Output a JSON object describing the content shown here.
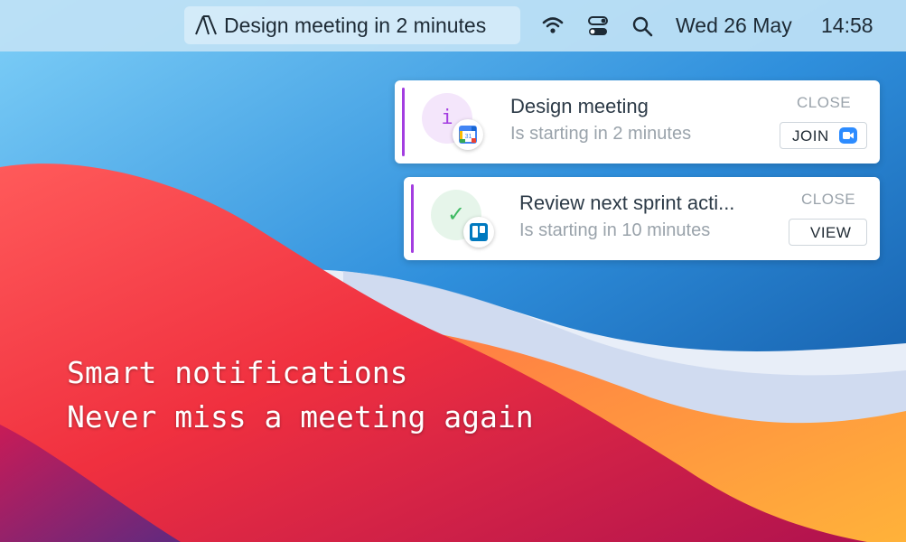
{
  "menubar": {
    "event_text": "Design meeting in 2 minutes",
    "date": "Wed 26 May",
    "time": "14:58",
    "icons": [
      "app-logo-icon",
      "wifi-icon",
      "control-center-icon",
      "search-icon"
    ]
  },
  "notifications": [
    {
      "title": "Design meeting",
      "subtitle": "Is starting in 2 minutes",
      "close_label": "CLOSE",
      "action_label": "JOIN",
      "glyph": "i",
      "source_icon": "google-calendar-icon",
      "action_icon": "zoom-video-icon",
      "accent": "#a33de0"
    },
    {
      "title": "Review next sprint acti...",
      "subtitle": "Is starting in 10 minutes",
      "close_label": "CLOSE",
      "action_label": "VIEW",
      "glyph": "✓",
      "source_icon": "trello-icon",
      "accent": "#a33de0"
    }
  ],
  "tagline": {
    "line1": "Smart notifications",
    "line2": "Never miss a meeting again"
  }
}
